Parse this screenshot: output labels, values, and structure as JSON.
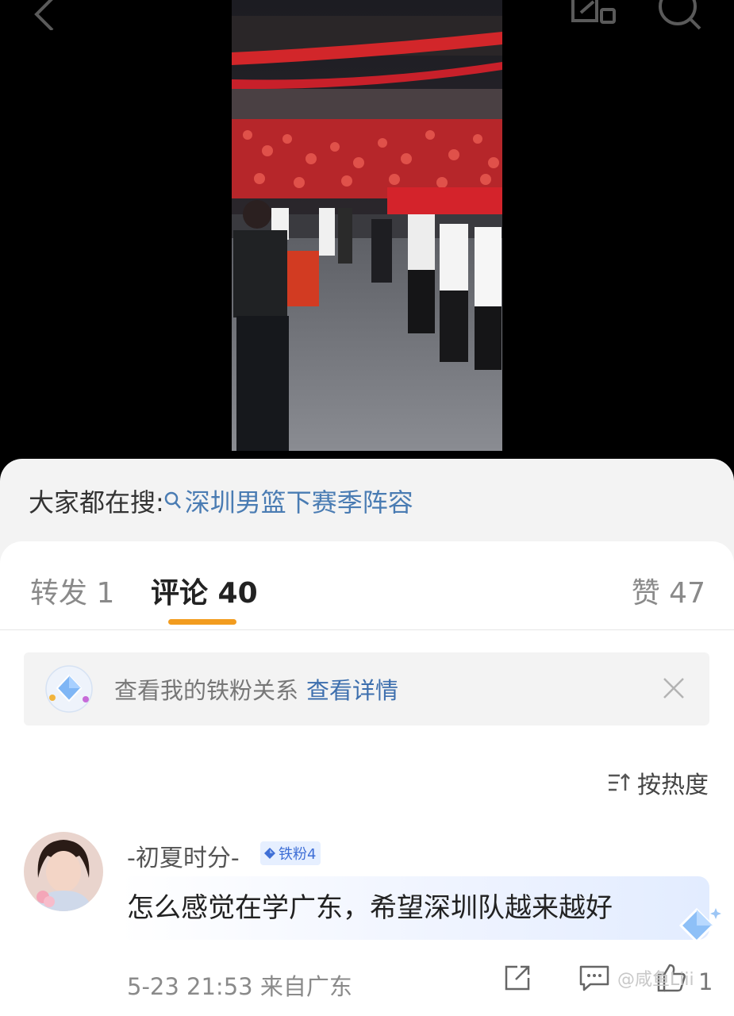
{
  "top_bar": {
    "back_icon": "chevron-left-icon",
    "share_icon": "share-screen-icon",
    "search_icon": "search-icon"
  },
  "video": {
    "description_icon": "video-thumbnail"
  },
  "hot_search": {
    "label": "大家都在搜:",
    "query": "深圳男篮下赛季阵容"
  },
  "tabs": {
    "repost": "转发 1",
    "comments": "评论 40",
    "likes": "赞 47"
  },
  "fan_banner": {
    "text": "查看我的铁粉关系",
    "link": "查看详情"
  },
  "sort": {
    "label": "按热度"
  },
  "comment": {
    "username": "-初夏时分-",
    "badge": "铁粉4",
    "text": "怎么感觉在学广东，希望深圳队越来越好",
    "meta": "5-23 21:53  来自广东",
    "like_count": "1"
  },
  "watermark": "@咸鱼Liii",
  "colors": {
    "accent_orange": "#f29c1f",
    "link_blue": "#4a7cb3"
  }
}
